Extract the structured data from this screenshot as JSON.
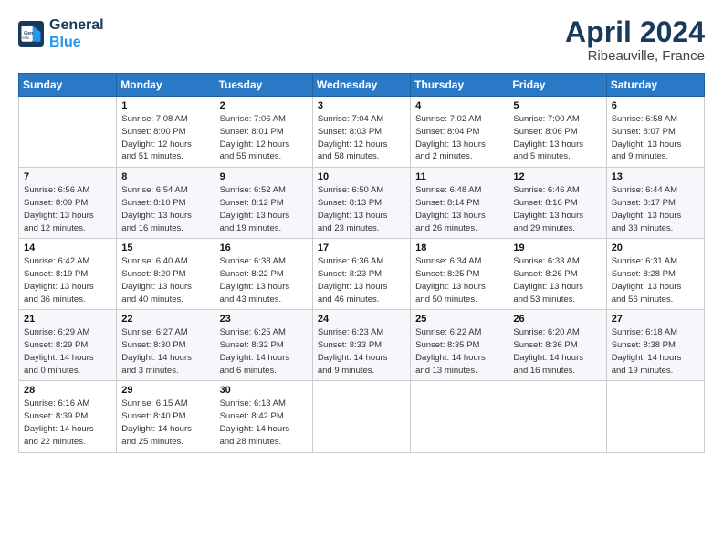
{
  "logo": {
    "line1": "General",
    "line2": "Blue"
  },
  "title": {
    "month_year": "April 2024",
    "location": "Ribeauville, France"
  },
  "calendar": {
    "headers": [
      "Sunday",
      "Monday",
      "Tuesday",
      "Wednesday",
      "Thursday",
      "Friday",
      "Saturday"
    ],
    "weeks": [
      [
        {
          "day": "",
          "info": ""
        },
        {
          "day": "1",
          "info": "Sunrise: 7:08 AM\nSunset: 8:00 PM\nDaylight: 12 hours\nand 51 minutes."
        },
        {
          "day": "2",
          "info": "Sunrise: 7:06 AM\nSunset: 8:01 PM\nDaylight: 12 hours\nand 55 minutes."
        },
        {
          "day": "3",
          "info": "Sunrise: 7:04 AM\nSunset: 8:03 PM\nDaylight: 12 hours\nand 58 minutes."
        },
        {
          "day": "4",
          "info": "Sunrise: 7:02 AM\nSunset: 8:04 PM\nDaylight: 13 hours\nand 2 minutes."
        },
        {
          "day": "5",
          "info": "Sunrise: 7:00 AM\nSunset: 8:06 PM\nDaylight: 13 hours\nand 5 minutes."
        },
        {
          "day": "6",
          "info": "Sunrise: 6:58 AM\nSunset: 8:07 PM\nDaylight: 13 hours\nand 9 minutes."
        }
      ],
      [
        {
          "day": "7",
          "info": "Sunrise: 6:56 AM\nSunset: 8:09 PM\nDaylight: 13 hours\nand 12 minutes."
        },
        {
          "day": "8",
          "info": "Sunrise: 6:54 AM\nSunset: 8:10 PM\nDaylight: 13 hours\nand 16 minutes."
        },
        {
          "day": "9",
          "info": "Sunrise: 6:52 AM\nSunset: 8:12 PM\nDaylight: 13 hours\nand 19 minutes."
        },
        {
          "day": "10",
          "info": "Sunrise: 6:50 AM\nSunset: 8:13 PM\nDaylight: 13 hours\nand 23 minutes."
        },
        {
          "day": "11",
          "info": "Sunrise: 6:48 AM\nSunset: 8:14 PM\nDaylight: 13 hours\nand 26 minutes."
        },
        {
          "day": "12",
          "info": "Sunrise: 6:46 AM\nSunset: 8:16 PM\nDaylight: 13 hours\nand 29 minutes."
        },
        {
          "day": "13",
          "info": "Sunrise: 6:44 AM\nSunset: 8:17 PM\nDaylight: 13 hours\nand 33 minutes."
        }
      ],
      [
        {
          "day": "14",
          "info": "Sunrise: 6:42 AM\nSunset: 8:19 PM\nDaylight: 13 hours\nand 36 minutes."
        },
        {
          "day": "15",
          "info": "Sunrise: 6:40 AM\nSunset: 8:20 PM\nDaylight: 13 hours\nand 40 minutes."
        },
        {
          "day": "16",
          "info": "Sunrise: 6:38 AM\nSunset: 8:22 PM\nDaylight: 13 hours\nand 43 minutes."
        },
        {
          "day": "17",
          "info": "Sunrise: 6:36 AM\nSunset: 8:23 PM\nDaylight: 13 hours\nand 46 minutes."
        },
        {
          "day": "18",
          "info": "Sunrise: 6:34 AM\nSunset: 8:25 PM\nDaylight: 13 hours\nand 50 minutes."
        },
        {
          "day": "19",
          "info": "Sunrise: 6:33 AM\nSunset: 8:26 PM\nDaylight: 13 hours\nand 53 minutes."
        },
        {
          "day": "20",
          "info": "Sunrise: 6:31 AM\nSunset: 8:28 PM\nDaylight: 13 hours\nand 56 minutes."
        }
      ],
      [
        {
          "day": "21",
          "info": "Sunrise: 6:29 AM\nSunset: 8:29 PM\nDaylight: 14 hours\nand 0 minutes."
        },
        {
          "day": "22",
          "info": "Sunrise: 6:27 AM\nSunset: 8:30 PM\nDaylight: 14 hours\nand 3 minutes."
        },
        {
          "day": "23",
          "info": "Sunrise: 6:25 AM\nSunset: 8:32 PM\nDaylight: 14 hours\nand 6 minutes."
        },
        {
          "day": "24",
          "info": "Sunrise: 6:23 AM\nSunset: 8:33 PM\nDaylight: 14 hours\nand 9 minutes."
        },
        {
          "day": "25",
          "info": "Sunrise: 6:22 AM\nSunset: 8:35 PM\nDaylight: 14 hours\nand 13 minutes."
        },
        {
          "day": "26",
          "info": "Sunrise: 6:20 AM\nSunset: 8:36 PM\nDaylight: 14 hours\nand 16 minutes."
        },
        {
          "day": "27",
          "info": "Sunrise: 6:18 AM\nSunset: 8:38 PM\nDaylight: 14 hours\nand 19 minutes."
        }
      ],
      [
        {
          "day": "28",
          "info": "Sunrise: 6:16 AM\nSunset: 8:39 PM\nDaylight: 14 hours\nand 22 minutes."
        },
        {
          "day": "29",
          "info": "Sunrise: 6:15 AM\nSunset: 8:40 PM\nDaylight: 14 hours\nand 25 minutes."
        },
        {
          "day": "30",
          "info": "Sunrise: 6:13 AM\nSunset: 8:42 PM\nDaylight: 14 hours\nand 28 minutes."
        },
        {
          "day": "",
          "info": ""
        },
        {
          "day": "",
          "info": ""
        },
        {
          "day": "",
          "info": ""
        },
        {
          "day": "",
          "info": ""
        }
      ]
    ]
  }
}
